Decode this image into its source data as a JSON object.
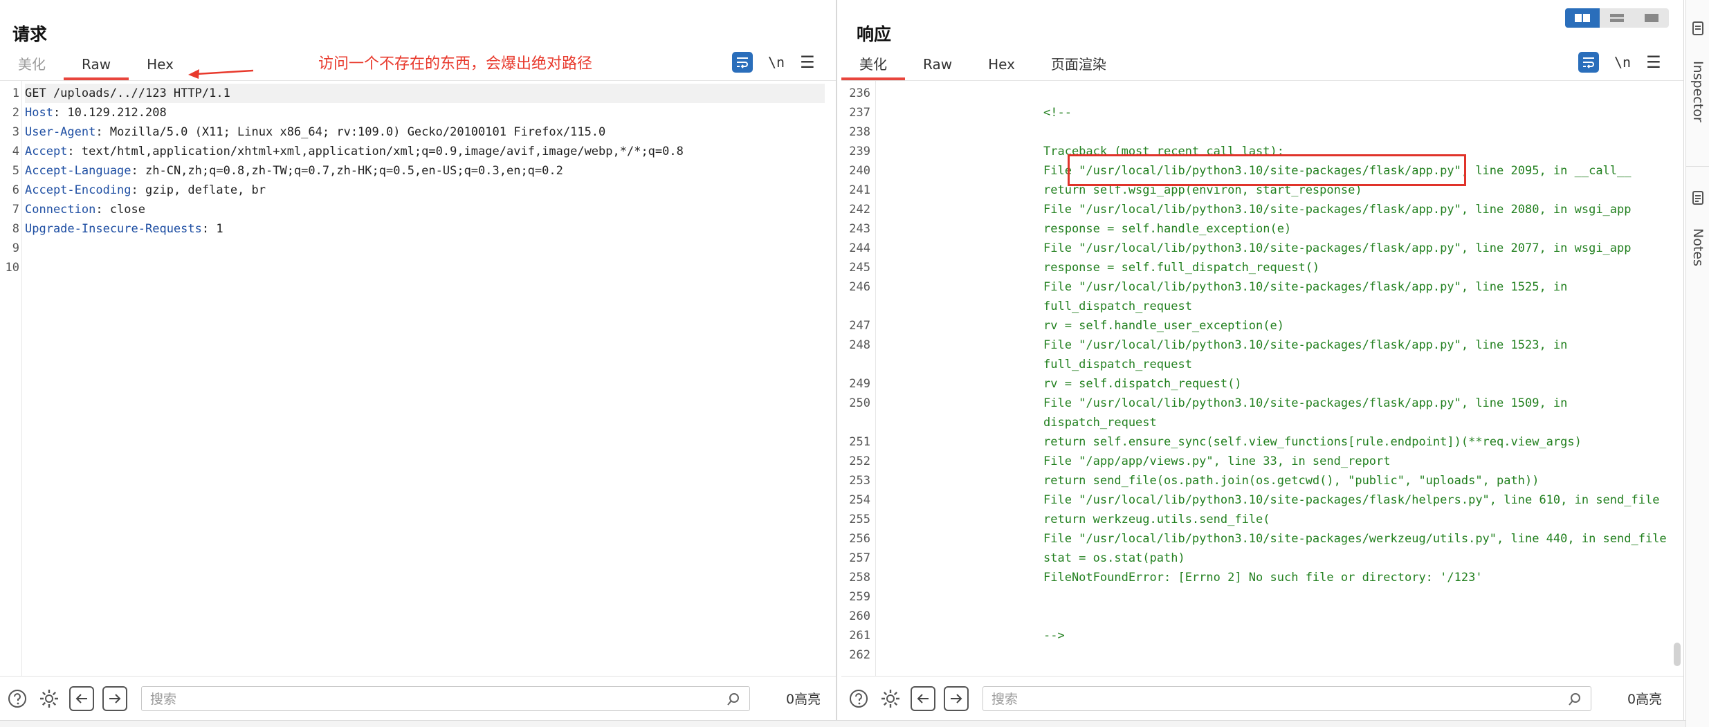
{
  "request": {
    "title": "请求",
    "tabs": [
      "美化",
      "Raw",
      "Hex"
    ],
    "active_tab": "Raw",
    "toolbar": {
      "newline_label": "\\n"
    },
    "lines": [
      {
        "num": "1",
        "parts": [
          {
            "t": "GET /uploads/..//123 HTTP/1.1",
            "k": "plain"
          }
        ]
      },
      {
        "num": "2",
        "parts": [
          {
            "t": "Host",
            "k": "name"
          },
          {
            "t": ": 10.129.212.208",
            "k": "val"
          }
        ]
      },
      {
        "num": "3",
        "parts": [
          {
            "t": "User-Agent",
            "k": "name"
          },
          {
            "t": ": Mozilla/5.0 (X11; Linux x86_64; rv:109.0) Gecko/20100101 Firefox/115.0",
            "k": "val"
          }
        ]
      },
      {
        "num": "4",
        "parts": [
          {
            "t": "Accept",
            "k": "name"
          },
          {
            "t": ": text/html,application/xhtml+xml,application/xml;q=0.9,image/avif,image/webp,*/*;q=0.8",
            "k": "val"
          }
        ]
      },
      {
        "num": "5",
        "parts": [
          {
            "t": "Accept-Language",
            "k": "name"
          },
          {
            "t": ": zh-CN,zh;q=0.8,zh-TW;q=0.7,zh-HK;q=0.5,en-US;q=0.3,en;q=0.2",
            "k": "val"
          }
        ]
      },
      {
        "num": "6",
        "parts": [
          {
            "t": "Accept-Encoding",
            "k": "name"
          },
          {
            "t": ": gzip, deflate, br",
            "k": "val"
          }
        ]
      },
      {
        "num": "7",
        "parts": [
          {
            "t": "Connection",
            "k": "name"
          },
          {
            "t": ": close",
            "k": "val"
          }
        ]
      },
      {
        "num": "8",
        "parts": [
          {
            "t": "Upgrade-Insecure-Requests",
            "k": "name"
          },
          {
            "t": ": 1",
            "k": "val"
          }
        ]
      },
      {
        "num": "9",
        "parts": []
      },
      {
        "num": "10",
        "parts": []
      }
    ],
    "search_placeholder": "搜索",
    "highlight_count": "0高亮"
  },
  "response": {
    "title": "响应",
    "tabs": [
      "美化",
      "Raw",
      "Hex",
      "页面渲染"
    ],
    "active_tab": "美化",
    "toolbar": {
      "newline_label": "\\n"
    },
    "lines": [
      {
        "num": "236",
        "text": ""
      },
      {
        "num": "237",
        "text": "<!--"
      },
      {
        "num": "238",
        "text": ""
      },
      {
        "num": "239",
        "text": "Traceback (most recent call last):"
      },
      {
        "num": "240",
        "text": "File \"/usr/local/lib/python3.10/site-packages/flask/app.py\", line 2095, in __call__"
      },
      {
        "num": "241",
        "text": "return self.wsgi_app(environ, start_response)"
      },
      {
        "num": "242",
        "text": "File \"/usr/local/lib/python3.10/site-packages/flask/app.py\", line 2080, in wsgi_app"
      },
      {
        "num": "243",
        "text": "response = self.handle_exception(e)"
      },
      {
        "num": "244",
        "text": "File \"/usr/local/lib/python3.10/site-packages/flask/app.py\", line 2077, in wsgi_app"
      },
      {
        "num": "245",
        "text": "response = self.full_dispatch_request()"
      },
      {
        "num": "246",
        "text": "File \"/usr/local/lib/python3.10/site-packages/flask/app.py\", line 1525, in"
      },
      {
        "num": "",
        "text": "full_dispatch_request"
      },
      {
        "num": "247",
        "text": "rv = self.handle_user_exception(e)"
      },
      {
        "num": "248",
        "text": "File \"/usr/local/lib/python3.10/site-packages/flask/app.py\", line 1523, in"
      },
      {
        "num": "",
        "text": "full_dispatch_request"
      },
      {
        "num": "249",
        "text": "rv = self.dispatch_request()"
      },
      {
        "num": "250",
        "text": "File \"/usr/local/lib/python3.10/site-packages/flask/app.py\", line 1509, in"
      },
      {
        "num": "",
        "text": "dispatch_request"
      },
      {
        "num": "251",
        "text": "return self.ensure_sync(self.view_functions[rule.endpoint])(**req.view_args)"
      },
      {
        "num": "252",
        "text": "File \"/app/app/views.py\", line 33, in send_report"
      },
      {
        "num": "253",
        "text": "return send_file(os.path.join(os.getcwd(), \"public\", \"uploads\", path))"
      },
      {
        "num": "254",
        "text": "File \"/usr/local/lib/python3.10/site-packages/flask/helpers.py\", line 610, in send_file"
      },
      {
        "num": "255",
        "text": "return werkzeug.utils.send_file("
      },
      {
        "num": "256",
        "text": "File \"/usr/local/lib/python3.10/site-packages/werkzeug/utils.py\", line 440, in send_file"
      },
      {
        "num": "257",
        "text": "stat = os.stat(path)"
      },
      {
        "num": "258",
        "text": "FileNotFoundError: [Errno 2] No such file or directory: '/123'"
      },
      {
        "num": "259",
        "text": ""
      },
      {
        "num": "260",
        "text": ""
      },
      {
        "num": "261",
        "text": "-->"
      },
      {
        "num": "262",
        "text": ""
      }
    ],
    "search_placeholder": "搜索",
    "highlight_count": "0高亮"
  },
  "annotation": {
    "text": "访问一个不存在的东西，会爆出绝对路径",
    "color": "#e8392c"
  },
  "side_rail": {
    "items": [
      "Inspector",
      "Notes"
    ]
  },
  "colors": {
    "accent_tab": "#e8453c",
    "header_name": "#1f4fa3",
    "response_text": "#22801f",
    "primary_blue": "#2a6ebb"
  }
}
